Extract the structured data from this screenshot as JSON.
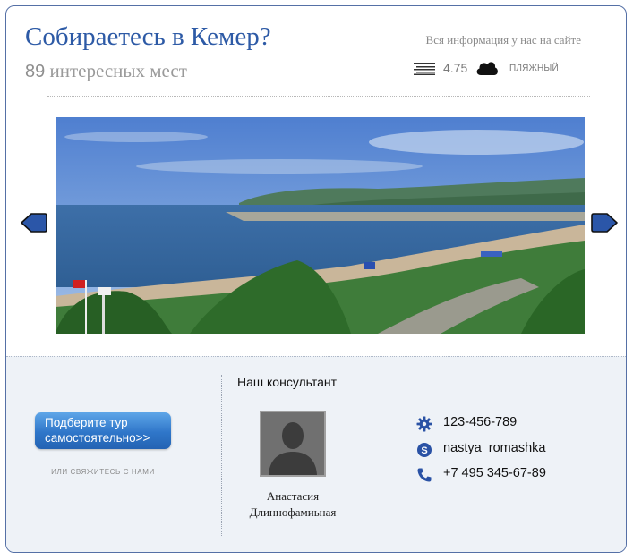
{
  "header": {
    "title": "Собираетесь в Кемер?",
    "places_count": "89",
    "places_label": "интересных мест",
    "info_text": "Вся информация у нас на сайте",
    "temperature": "4.75",
    "beach_label": "ПЛЯЖНЫЙ"
  },
  "icons": {
    "sea": "sea-waves-icon",
    "weather": "cloud-icon",
    "prev": "arrow-left-icon",
    "next": "arrow-right-icon",
    "phone1": "gear-icon",
    "skype": "skype-icon",
    "phone2": "phone-icon"
  },
  "tour_button": {
    "line1": "Подберите тур",
    "line2": "самостоятельно>>"
  },
  "contact_us_label": "ИЛИ СВЯЖИТЕСЬ С НАМИ",
  "consultant": {
    "heading": "Наш консультант",
    "first_name": "Анастасия",
    "last_name": "Длиннофамиьная"
  },
  "contacts": [
    {
      "value": "123-456-789"
    },
    {
      "value": "nastya_romashka"
    },
    {
      "value": "+7 495 345-67-89"
    }
  ],
  "colors": {
    "accent": "#2d5aa6",
    "border": "#5570a6",
    "button": "#2f76c9",
    "panel": "#eef2f7"
  }
}
